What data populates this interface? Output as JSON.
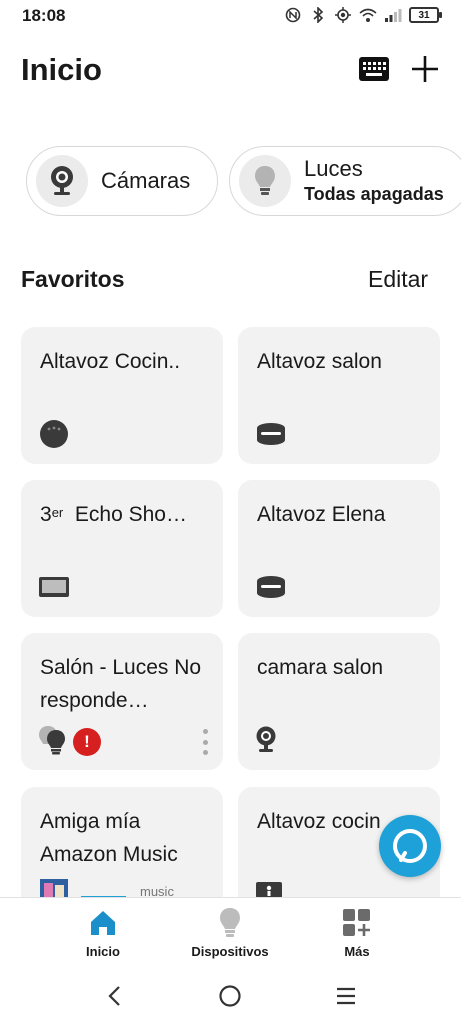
{
  "status_bar": {
    "time": "18:08",
    "battery": "31",
    "icons": [
      "nfc-icon",
      "bluetooth-icon",
      "location-icon",
      "wifi-icon",
      "signal-icon",
      "battery-icon"
    ]
  },
  "header": {
    "title": "Inicio",
    "keyboard_icon": "keyboard-icon",
    "add_icon": "plus-icon"
  },
  "quick_chips": [
    {
      "label": "Cámaras",
      "icon": "camera-icon"
    },
    {
      "label": "Luces",
      "sublabel": "Todas apagadas",
      "icon": "bulb-icon"
    }
  ],
  "favorites": {
    "title": "Favoritos",
    "edit_label": "Editar",
    "tiles": [
      {
        "name": "Altavoz  Cocin..",
        "icon": "echo-dot-icon"
      },
      {
        "name": "Altavoz salon",
        "icon": "echo-speaker-icon"
      },
      {
        "name": "Echo Sho…",
        "prefix": "3",
        "prefix_sup": "er",
        "icon": "echo-show-icon"
      },
      {
        "name": "Altavoz Elena",
        "icon": "echo-speaker-icon"
      },
      {
        "name": "Salón - Luces No responde…",
        "icon": "bulb-group-icon",
        "status_icon": "alert-icon",
        "menu_icon": "more-vertical-icon"
      },
      {
        "name": "camara salon",
        "icon": "camera-icon"
      },
      {
        "name": "Amiga mía Amazon Music",
        "icon": "album-art-icon",
        "peek_text": "music"
      },
      {
        "name": "Altavoz cocin",
        "icon": "echo-device-icon"
      }
    ]
  },
  "alexa_button": {
    "icon": "alexa-icon"
  },
  "bottom_nav": {
    "items": [
      {
        "label": "Inicio",
        "icon": "home-icon",
        "active": true
      },
      {
        "label": "Dispositivos",
        "icon": "devices-bulb-icon",
        "active": false
      },
      {
        "label": "Más",
        "icon": "more-grid-icon",
        "active": false
      }
    ]
  },
  "system_nav": [
    "back-icon",
    "home-circle-icon",
    "recents-icon"
  ],
  "colors": {
    "accent": "#1ea0d8",
    "active_nav": "#1b8fc9",
    "alert": "#d61f1f",
    "tile_bg": "#f2f2f2"
  }
}
